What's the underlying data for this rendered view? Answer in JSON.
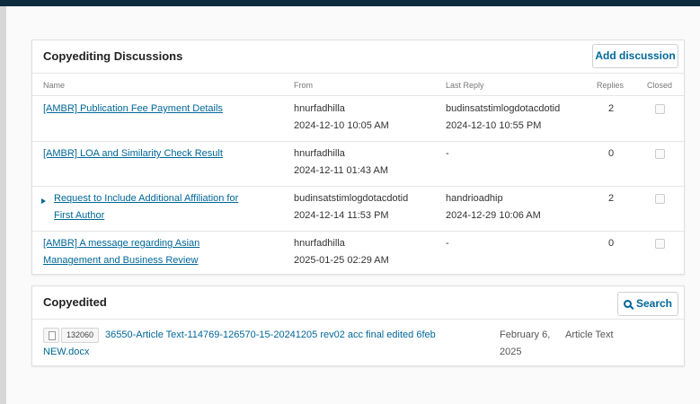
{
  "discussions": {
    "title": "Copyediting Discussions",
    "add_button": "Add discussion",
    "columns": {
      "name": "Name",
      "from": "From",
      "last_reply": "Last Reply",
      "replies": "Replies",
      "closed": "Closed"
    },
    "rows": [
      {
        "name": "[AMBR] Publication Fee Payment Details",
        "from_user": "hnurfadhilla",
        "from_date": "2024-12-10 10:05 AM",
        "reply_user": "budinsatstimlogdotacdotid",
        "reply_date": "2024-12-10 10:55 PM",
        "replies": "2",
        "expandable": false
      },
      {
        "name": "[AMBR] LOA and Similarity Check Result",
        "from_user": "hnurfadhilla",
        "from_date": "2024-12-11 01:43 AM",
        "reply_user": "-",
        "reply_date": "",
        "replies": "0",
        "expandable": false
      },
      {
        "name_line1": "Request to Include Additional Affiliation for",
        "name_line2": "First Author",
        "from_user": "budinsatstimlogdotacdotid",
        "from_date": "2024-12-14 11:53 PM",
        "reply_user": "handrioadhip",
        "reply_date": "2024-12-29 10:06 AM",
        "replies": "2",
        "expandable": true
      },
      {
        "name_line1": "[AMBR] A message regarding Asian",
        "name_line2": "Management and Business Review",
        "from_user": "hnurfadhilla",
        "from_date": "2025-01-25 02:29 AM",
        "reply_user": "-",
        "reply_date": "",
        "replies": "0",
        "expandable": false
      }
    ]
  },
  "copyedited": {
    "title": "Copyedited",
    "search_button": "Search",
    "file": {
      "id": "132060",
      "name": "36550-Article Text-114769-126570-15-20241205 rev02 acc final edited 6feb NEW.docx",
      "date": "February 6, 2025",
      "type": "Article Text"
    }
  },
  "colors": {
    "topbar": "#0c2b3d",
    "link": "#006798"
  },
  "icons": [
    "expand-caret-icon",
    "file-icon",
    "search-icon",
    "checkbox"
  ]
}
